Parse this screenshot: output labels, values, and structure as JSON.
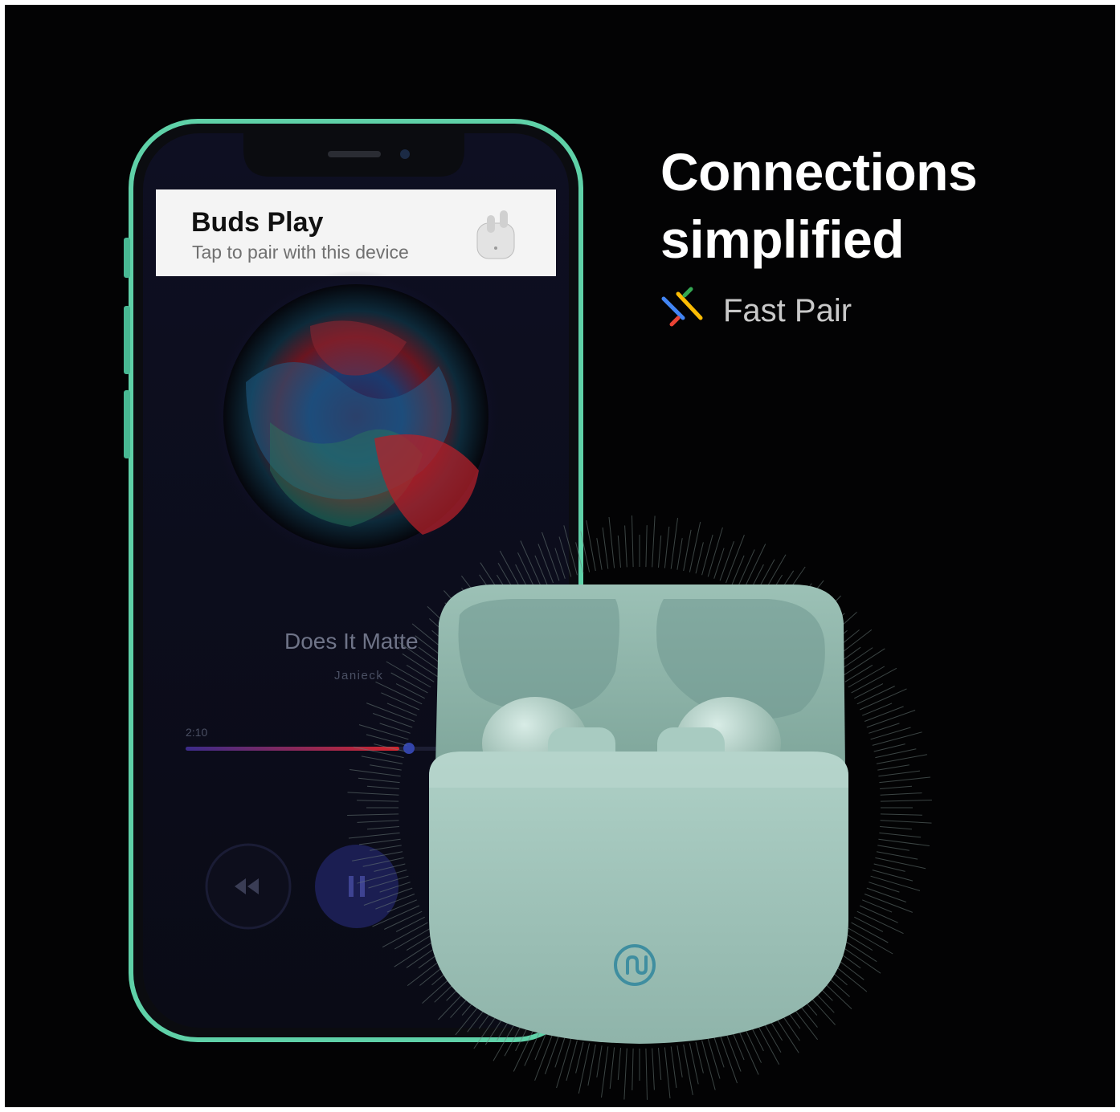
{
  "headline": {
    "line1": "Connections",
    "line2": "simplified"
  },
  "fast_pair": {
    "label": "Fast Pair",
    "icon": "google-fast-pair-icon"
  },
  "phone": {
    "notification": {
      "title": "Buds Play",
      "subtitle": "Tap to pair with this device",
      "icon": "earbuds-icon"
    },
    "player": {
      "song_title": "Does It Matte",
      "artist": "Janieck",
      "elapsed": "2:10",
      "progress": 0.72,
      "controls": [
        "rewind-icon",
        "pause-icon"
      ]
    }
  },
  "product": {
    "logo": "brand-logo-icon"
  },
  "colors": {
    "background": "#030304",
    "phone_frame": "#5fd1a8",
    "case": "#9fc2b8",
    "logo": "#3f8ea0",
    "headline": "#ffffff",
    "fast_pair_text": "#c9c9c9"
  }
}
